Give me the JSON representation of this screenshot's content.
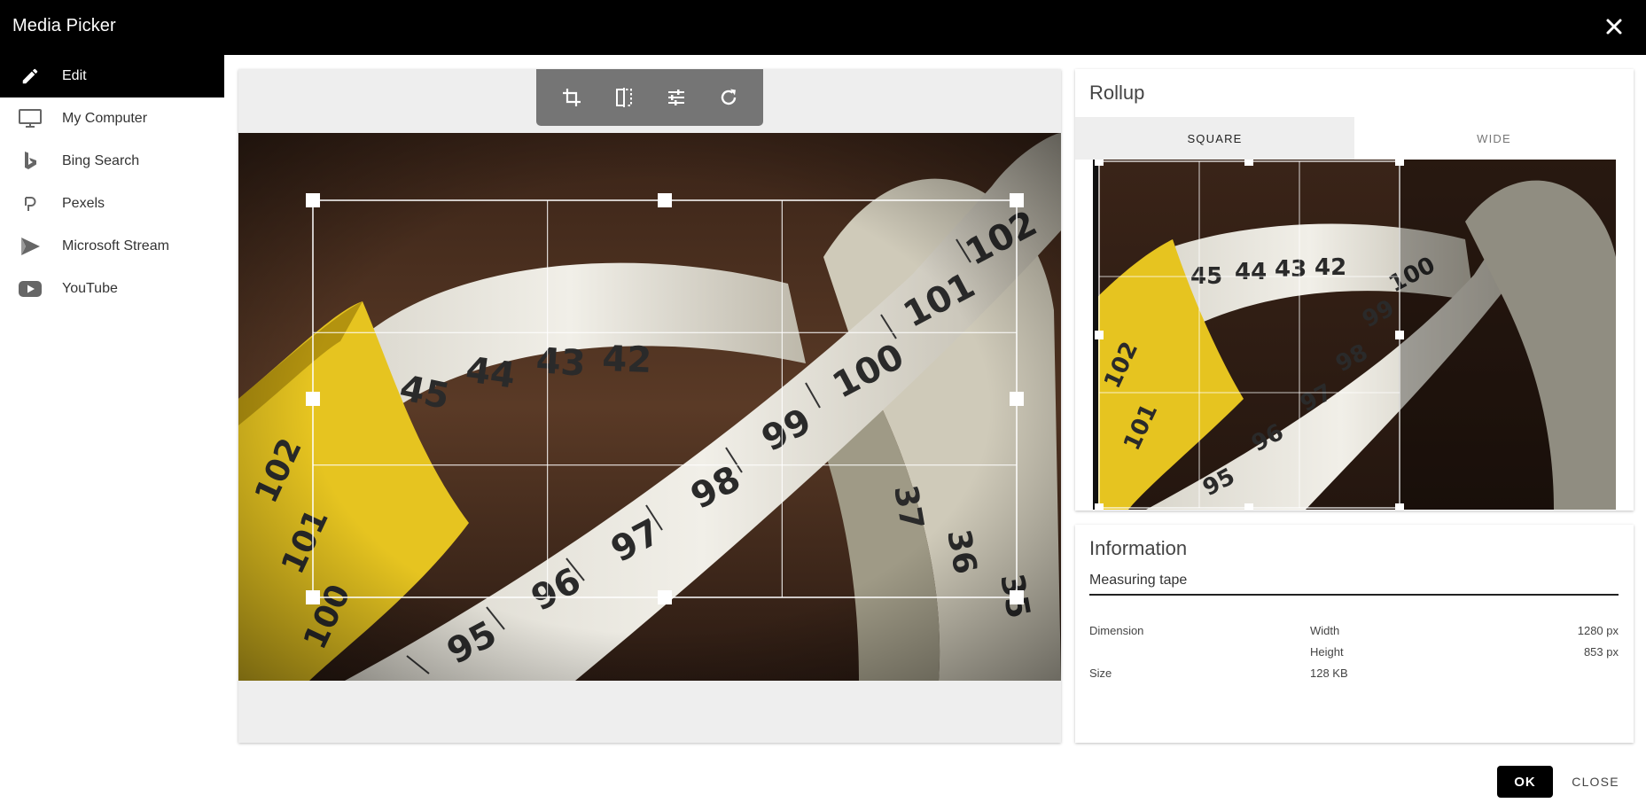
{
  "window": {
    "title": "Media Picker",
    "close_icon": "close-icon"
  },
  "sidebar": {
    "items": [
      {
        "label": "Edit",
        "icon": "pencil-icon",
        "active": true
      },
      {
        "label": "My Computer",
        "icon": "monitor-icon",
        "active": false
      },
      {
        "label": "Bing Search",
        "icon": "bing-icon",
        "active": false
      },
      {
        "label": "Pexels",
        "icon": "pexels-icon",
        "active": false
      },
      {
        "label": "Microsoft Stream",
        "icon": "stream-icon",
        "active": false
      },
      {
        "label": "YouTube",
        "icon": "youtube-icon",
        "active": false
      }
    ]
  },
  "editor": {
    "tools": [
      "crop-icon",
      "flip-icon",
      "adjust-icon",
      "rotate-icon"
    ]
  },
  "rollup": {
    "title": "Rollup",
    "tabs": [
      {
        "label": "SQUARE",
        "active": true
      },
      {
        "label": "WIDE",
        "active": false
      }
    ]
  },
  "info": {
    "title": "Information",
    "caption": "Measuring tape",
    "dimension_label": "Dimension",
    "width_label": "Width",
    "width_value": "1280 px",
    "height_label": "Height",
    "height_value": "853 px",
    "size_label": "Size",
    "size_value": "128 KB"
  },
  "footer": {
    "ok_label": "OK",
    "close_label": "CLOSE"
  },
  "colors": {
    "titlebar": "#000000",
    "active_nav": "#000000",
    "toolbar": "#757575",
    "panel_bg": "#eeeeee"
  }
}
